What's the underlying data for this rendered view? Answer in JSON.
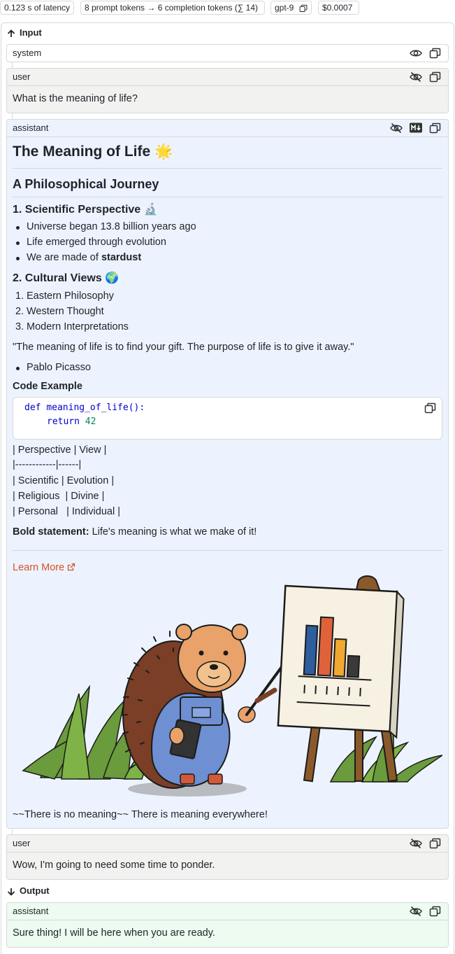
{
  "metrics": {
    "latency": "0.123 s of latency",
    "tokens": "8 prompt tokens → 6 completion tokens (∑ 14)",
    "model": "gpt-9",
    "cost": "$0.0007"
  },
  "input_label": "Input",
  "output_label": "Output",
  "messages": {
    "system": {
      "role": "system"
    },
    "user1": {
      "role": "user",
      "content": "What is the meaning of life?"
    },
    "assistant1": {
      "role": "assistant",
      "h1": "The Meaning of Life 🌟",
      "h2": "A Philosophical Journey",
      "s1_title": "1. Scientific Perspective 🔬",
      "s1_items": [
        "Universe began 13.8 billion years ago",
        "Life emerged through evolution",
        "We are made of "
      ],
      "s1_bold": "stardust",
      "s2_title": "2. Cultural Views 🌍",
      "s2_items": [
        "Eastern Philosophy",
        "Western Thought",
        "Modern Interpretations"
      ],
      "s2_nums": [
        "1.",
        "2.",
        "3."
      ],
      "quote": "\"The meaning of life is to find your gift. The purpose of life is to give it away.\"",
      "quote_author": "Pablo Picasso",
      "code_title": "Code Example",
      "code": {
        "kw1": "def",
        "fn": "meaning_of_life",
        "paren": "():",
        "kw2": "return",
        "num": "42"
      },
      "table_lines": [
        "| Perspective | View |",
        "|------------|------|",
        "| Scientific | Evolution |",
        "| Religious  | Divine |",
        "| Personal   | Individual |"
      ],
      "bold_label": "Bold statement:",
      "bold_text": " Life's meaning is what we make of it!",
      "link": "Learn More",
      "closing": "~~There is no meaning~~ There is meaning everywhere!"
    },
    "user2": {
      "role": "user",
      "content": "Wow, I'm going to need some time to ponder."
    },
    "assistant2": {
      "role": "assistant",
      "content": "Sure thing! I will be here when you are ready."
    }
  },
  "colors": {
    "user_bg": "#f2f2f0",
    "assistant_bg": "#edf3fe",
    "output_bg": "#edfbf1",
    "link": "#d4522a"
  },
  "icons": [
    "copy-icon",
    "eye-icon",
    "eye-off-icon",
    "markdown-icon",
    "arrow-up-icon",
    "arrow-down-icon",
    "external-link-icon"
  ]
}
